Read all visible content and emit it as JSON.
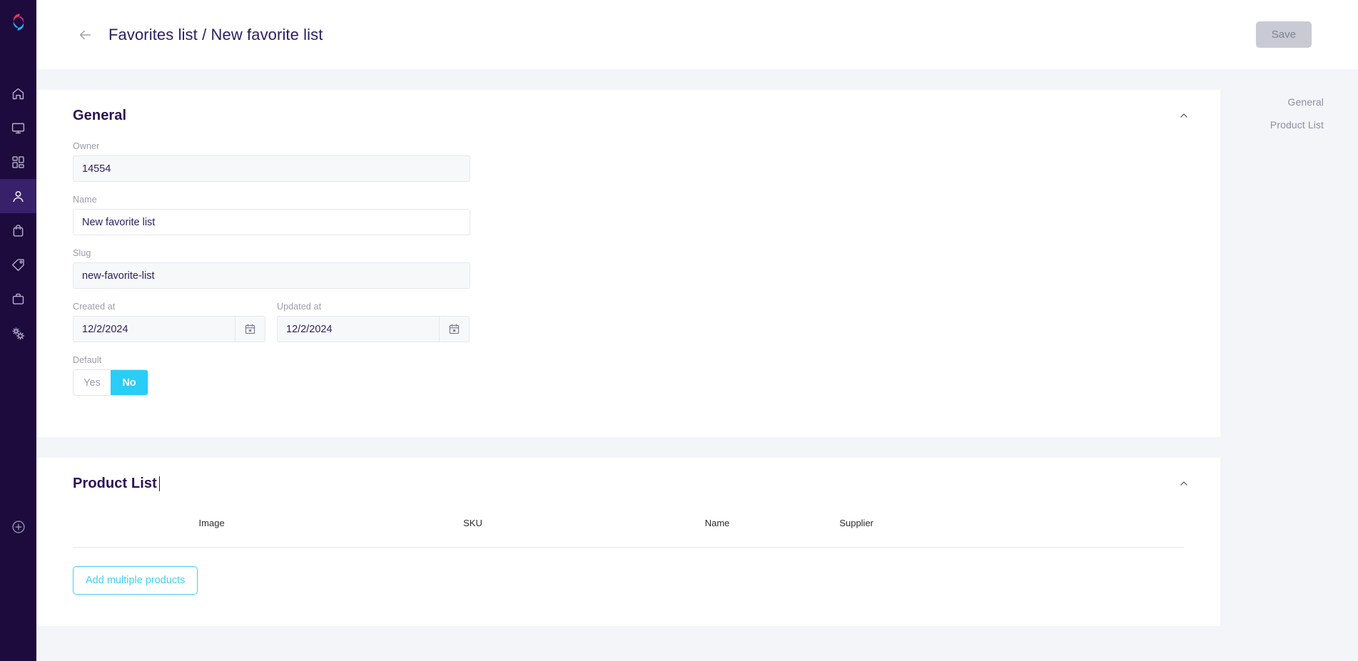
{
  "app": {
    "logo_name": "brand-swirl-logo",
    "accent_color": "#29cdf6",
    "sidebar_bg": "#1d0b3e",
    "page_bg": "#f4f5f8"
  },
  "sidebar": {
    "items": [
      {
        "icon": "home-icon",
        "label": "Home",
        "active": false
      },
      {
        "icon": "monitor-icon",
        "label": "Channels",
        "active": false
      },
      {
        "icon": "grid-icon",
        "label": "Dashboard",
        "active": false
      },
      {
        "icon": "user-icon",
        "label": "Customers",
        "active": true
      },
      {
        "icon": "shopping-bag-icon",
        "label": "Orders",
        "active": false
      },
      {
        "icon": "tag-icon",
        "label": "Products",
        "active": false
      },
      {
        "icon": "briefcase-icon",
        "label": "Suppliers",
        "active": false
      },
      {
        "icon": "settings-gears-icon",
        "label": "Settings",
        "active": false
      }
    ],
    "bottom_action": {
      "icon": "plus-circle-icon",
      "label": "Add"
    }
  },
  "topbar": {
    "back_icon": "arrow-left-icon",
    "breadcrumb": "Favorites list / New favorite list",
    "save_label": "Save",
    "save_disabled": true
  },
  "anchor_nav": {
    "items": [
      {
        "label": "General"
      },
      {
        "label": "Product List"
      }
    ]
  },
  "general_section": {
    "title": "General",
    "collapse_icon": "chevron-up-icon",
    "fields": {
      "owner": {
        "label": "Owner",
        "value": "14554",
        "placeholder": "",
        "disabled": true
      },
      "name": {
        "label": "Name",
        "value": "New favorite list",
        "placeholder": "",
        "disabled": false
      },
      "slug": {
        "label": "Slug",
        "value": "new-favorite-list",
        "placeholder": "",
        "disabled": true
      },
      "created_at": {
        "label": "Created at",
        "value": "12/2/2024",
        "placeholder": "",
        "icon": "calendar-icon"
      },
      "updated_at": {
        "label": "Updated at",
        "value": "12/2/2024",
        "placeholder": "",
        "icon": "calendar-icon"
      },
      "default": {
        "label": "Default",
        "options": [
          "Yes",
          "No"
        ],
        "selected": "No"
      }
    }
  },
  "product_list_section": {
    "title": "Product List",
    "collapse_icon": "chevron-up-icon",
    "columns": [
      "Image",
      "SKU",
      "Name",
      "Supplier"
    ],
    "rows": [],
    "add_button_label": "Add multiple products"
  }
}
